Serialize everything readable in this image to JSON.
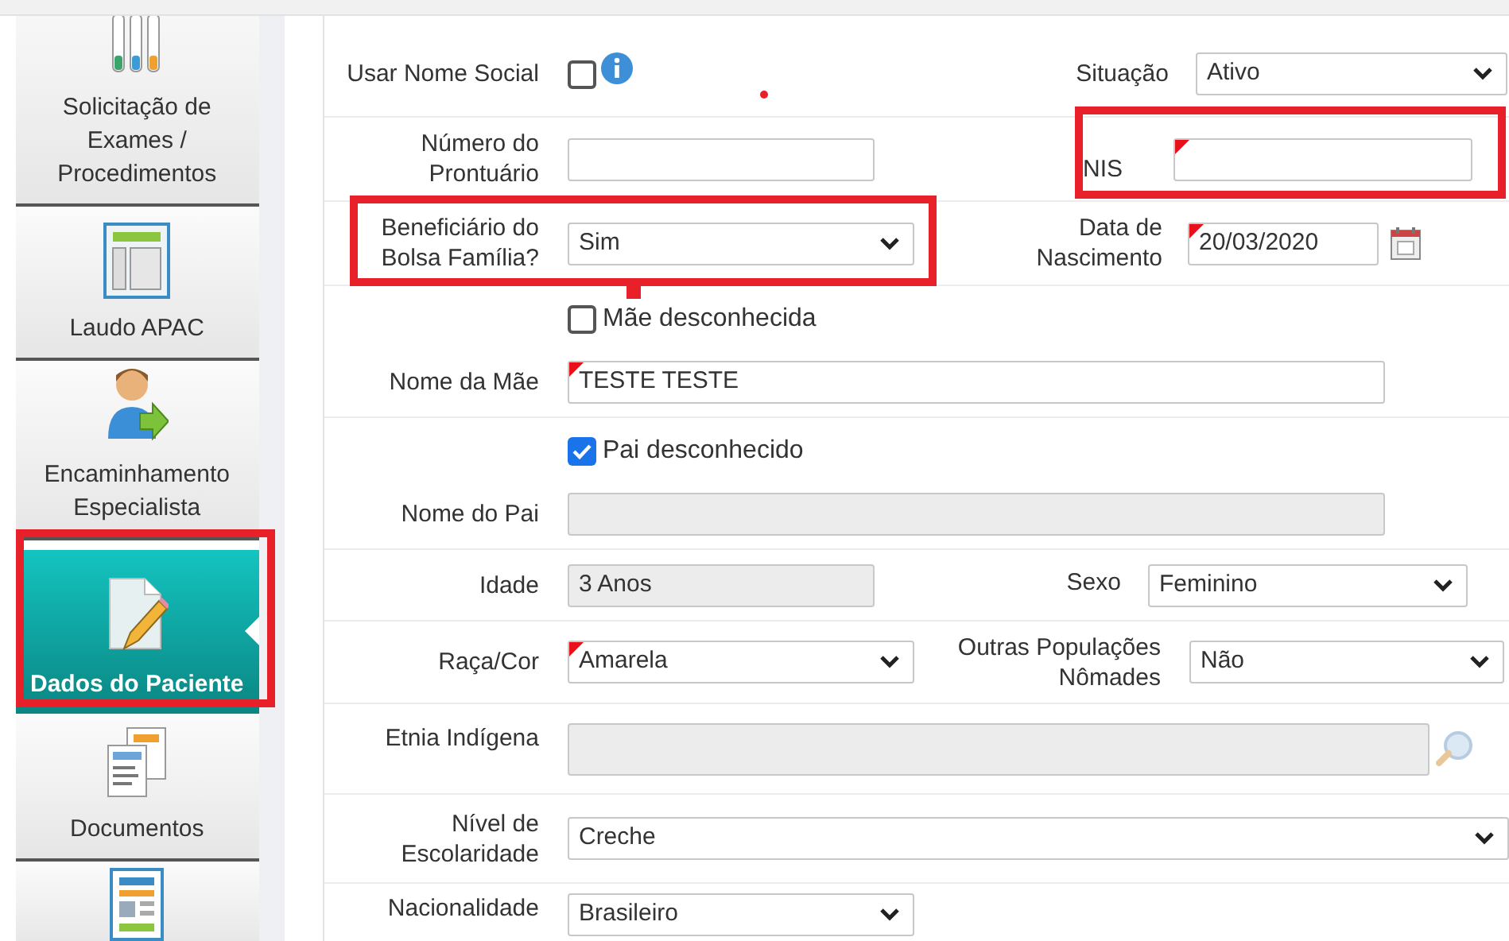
{
  "sidebar": {
    "items": [
      {
        "label": "Solicitação de Exames / Procedimentos",
        "kind": "tubes",
        "selected": false
      },
      {
        "label": "Laudo APAC",
        "kind": "layout",
        "selected": false
      },
      {
        "label": "Encaminhamento Especialista",
        "kind": "person",
        "selected": false
      },
      {
        "label": "Dados do Paciente",
        "kind": "edit",
        "selected": true,
        "highlighted": true
      },
      {
        "label": "Documentos",
        "kind": "docs",
        "selected": false
      },
      {
        "kind": "report",
        "selected": false
      }
    ]
  },
  "form": {
    "usar_nome_social": {
      "label": "Usar Nome Social",
      "checked": false
    },
    "situacao": {
      "label": "Situação",
      "value": "Ativo"
    },
    "numero_prontuario": {
      "label": "Número do Prontuário"
    },
    "nis": {
      "label": "NIS",
      "required": true,
      "highlighted": true
    },
    "bolsa_familia": {
      "label": "Beneficiário do Bolsa Família?",
      "value": "Sim",
      "highlighted": true
    },
    "data_nascimento": {
      "label": "Data de Nascimento",
      "value": "20/03/2020",
      "required": true
    },
    "mae_desconhecida": {
      "label": "Mãe desconhecida",
      "checked": false
    },
    "nome_mae": {
      "label": "Nome da Mãe",
      "value": "TESTE TESTE",
      "required": true,
      "disabled": false
    },
    "pai_desconhecido": {
      "label": "Pai desconhecido",
      "checked": true
    },
    "nome_pai": {
      "label": "Nome do Pai",
      "disabled": true
    },
    "idade": {
      "label": "Idade",
      "value": "3 Anos",
      "disabled": true
    },
    "sexo": {
      "label": "Sexo",
      "value": "Feminino"
    },
    "raca_cor": {
      "label": "Raça/Cor",
      "value": "Amarela",
      "required": true
    },
    "outras_populacoes": {
      "label": "Outras Populações Nômades",
      "value": "Não"
    },
    "etnia_indigena": {
      "label": "Etnia Indígena",
      "disabled": true
    },
    "nivel_escolaridade": {
      "label": "Nível de Escolaridade",
      "value": "Creche"
    },
    "nacionalidade": {
      "label": "Nacionalidade",
      "value": "Brasileiro"
    }
  }
}
